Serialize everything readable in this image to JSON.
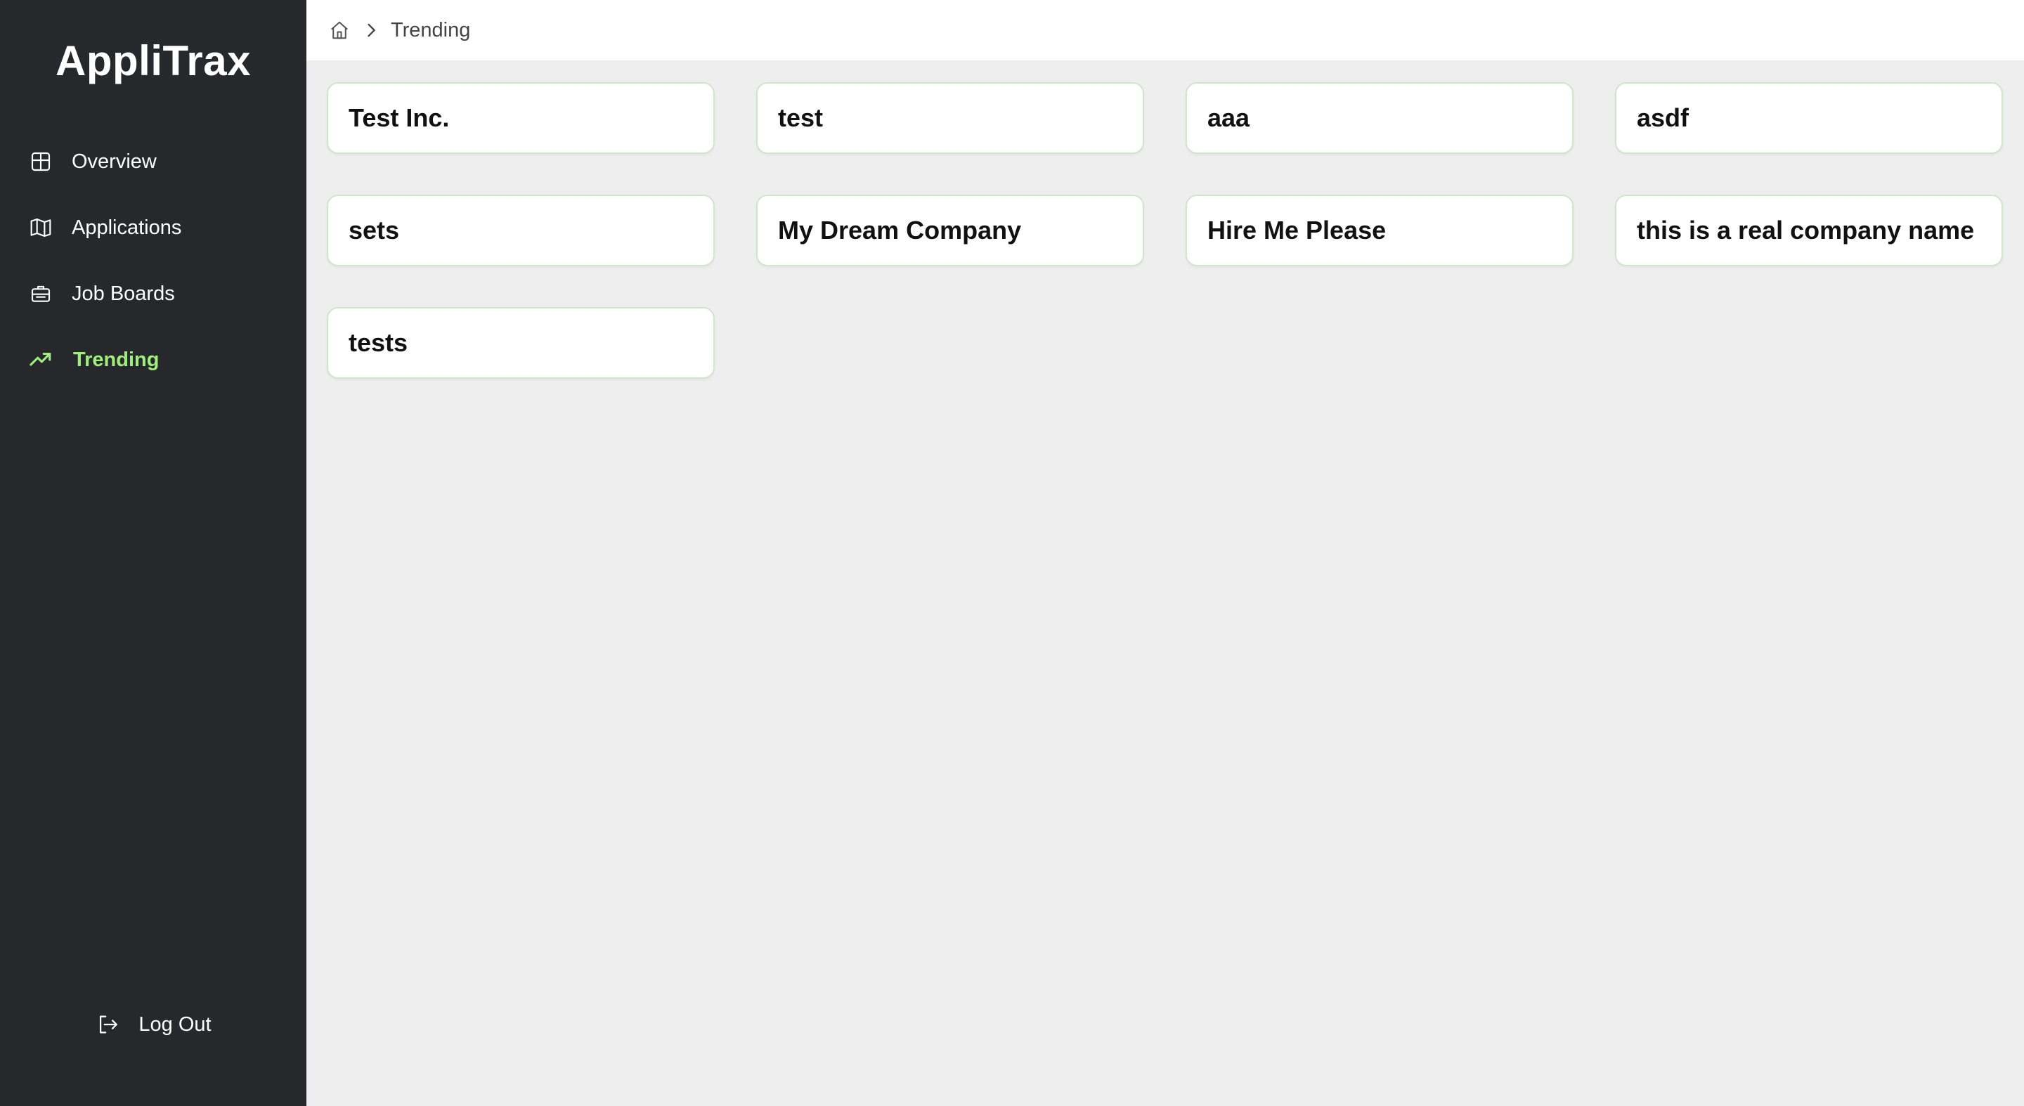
{
  "app": {
    "brand": "AppliTrax"
  },
  "sidebar": {
    "items": [
      {
        "label": "Overview",
        "icon": "grid-icon",
        "active": false
      },
      {
        "label": "Applications",
        "icon": "map-icon",
        "active": false
      },
      {
        "label": "Job Boards",
        "icon": "briefcase-icon",
        "active": false
      },
      {
        "label": "Trending",
        "icon": "trending-up-icon",
        "active": true
      }
    ],
    "logout_label": "Log Out",
    "logout_icon": "logout-icon"
  },
  "breadcrumb": {
    "home_icon": "home-icon",
    "separator_icon": "chevron-right-icon",
    "current": "Trending"
  },
  "companies": [
    "Test Inc.",
    "test",
    "aaa",
    "asdf",
    "sets",
    "My Dream Company",
    "Hire Me Please",
    "this is a real company name",
    "tests"
  ],
  "colors": {
    "sidebar_bg": "#26282b",
    "accent": "#9ef07a",
    "content_bg": "#eeeeee",
    "card_border": "#cfe6cb"
  }
}
